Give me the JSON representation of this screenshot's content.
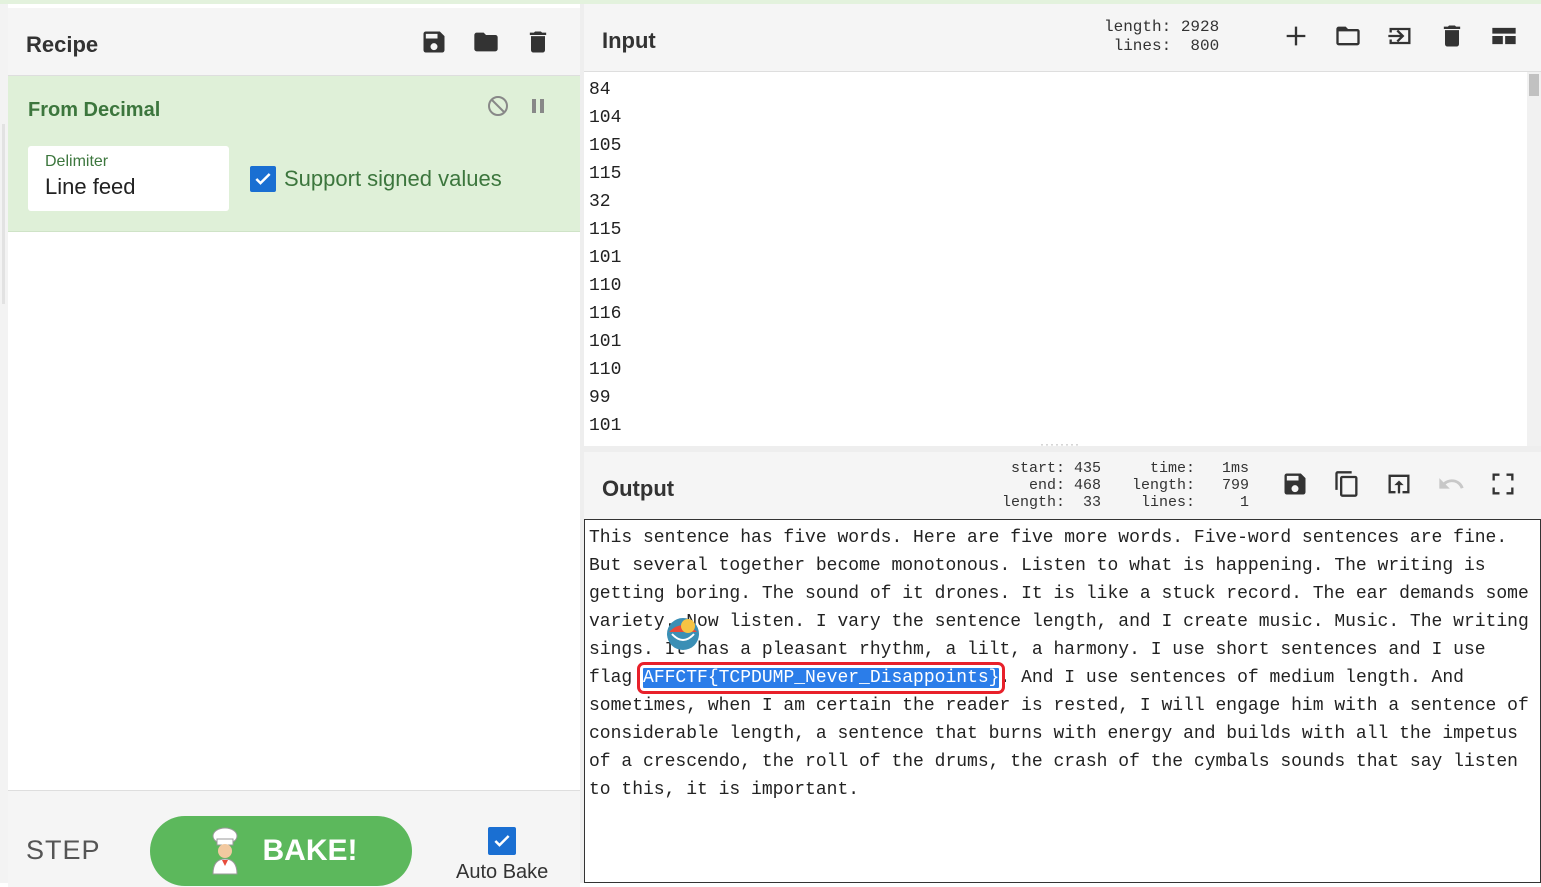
{
  "recipe": {
    "title": "Recipe",
    "header_icons": [
      "save-icon",
      "folder-icon",
      "trash-icon"
    ],
    "operation": {
      "name": "From Decimal",
      "delimiter_label": "Delimiter",
      "delimiter_value": "Line feed",
      "signed_label": "Support signed values",
      "signed_checked": true
    },
    "footer": {
      "step_label": "STEP",
      "bake_label": "BAKE!",
      "auto_bake_label": "Auto Bake",
      "auto_bake_checked": true
    }
  },
  "input": {
    "title": "Input",
    "stats": "length: 2928\n lines:  800",
    "icons": [
      "plus-icon",
      "open-folder-icon",
      "input-file-icon",
      "trash-icon",
      "layout-icon"
    ],
    "lines": [
      "84",
      "104",
      "105",
      "115",
      "32",
      "115",
      "101",
      "110",
      "116",
      "101",
      "110",
      "99",
      "101"
    ]
  },
  "output": {
    "title": "Output",
    "selection_stats": " start: 435\n   end: 468\nlength:  33",
    "info_stats": "  time:   1ms\nlength:   799\n lines:     1",
    "icons": [
      "save-icon",
      "copy-icon",
      "replace-input-icon",
      "undo-icon",
      "fullscreen-icon"
    ],
    "lines": [
      "This sentence has five words. Here are five more words. Five-word sentences are fine.",
      "But several together become monotonous. Listen to what is happening. The writing is",
      "getting boring. The sound of it drones. It is like a stuck record. The ear demands some",
      "variety. Now listen. I vary the sentence length, and I create music. Music. The writing",
      "sings. It has a pleasant rhythm, a lilt, a harmony. I use short sentences and I use",
      "__FLAG_LINE__",
      "sometimes, when I am certain the reader is rested, I will engage him with a sentence of",
      "considerable length, a sentence that burns with energy and builds with all the impetus",
      "of a crescendo, the roll of the drums, the crash of the cymbals sounds that say listen",
      "to this, it is important."
    ],
    "flag_prefix": "flag ",
    "flag_value": "AFFCTF{TCPDUMP_Never_Disappoints}",
    "flag_suffix": ". And I use sentences of medium length. And"
  }
}
